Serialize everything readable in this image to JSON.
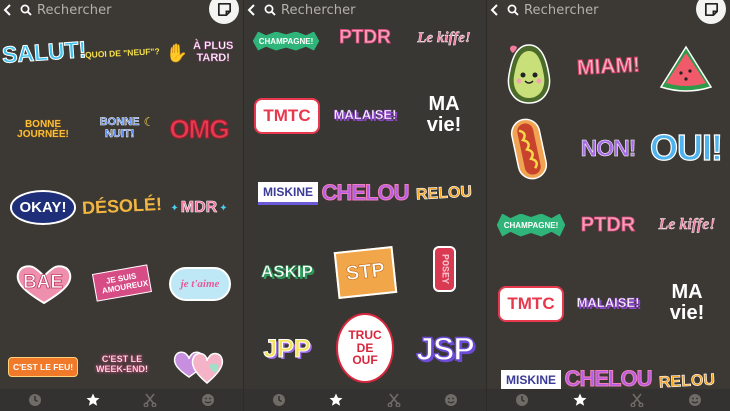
{
  "search": {
    "placeholder": "Rechercher"
  },
  "panels": [
    {
      "id": "panel-1",
      "stickers": [
        "SALUT!",
        "QUOI DE \"NEUF\"?",
        "À PLUS TARD!",
        "BONNE JOURNÉE!",
        "BONNE NUIT!",
        "OMG",
        "OKAY!",
        "DÉSOLÉ!",
        "MDR",
        "BAE",
        "JE SUIS AMOUREUX",
        "je t'aime",
        "C'EST LE FEU!",
        "C'EST LE WEEK-END!"
      ]
    },
    {
      "id": "panel-2",
      "stickers": [
        "CHAMPAGNE!",
        "PTDR",
        "Le kiffe!",
        "TMTC",
        "MALAISE!",
        "MA vie!",
        "MISKINE",
        "CHELOU",
        "RELOU",
        "ASKIP",
        "STP",
        "POSEY",
        "JPP",
        "TRUC DE OUF",
        "JSP"
      ]
    },
    {
      "id": "panel-3",
      "stickers": [
        "MIAM!",
        "NON!",
        "OUI!",
        "CHAMPAGNE!",
        "PTDR",
        "Le kiffe!",
        "TMTC",
        "MALAISE!",
        "MA vie!",
        "MISKINE",
        "CHELOU",
        "RELOU"
      ]
    }
  ],
  "colors": {
    "background": "#3c3935",
    "tab_active": "#ffffff",
    "tab_inactive": "#6f6b66"
  },
  "icons": [
    "back-chevron-icon",
    "search-icon",
    "sticker-icon",
    "clock-icon",
    "star-icon",
    "scissors-icon",
    "emoji-icon"
  ]
}
